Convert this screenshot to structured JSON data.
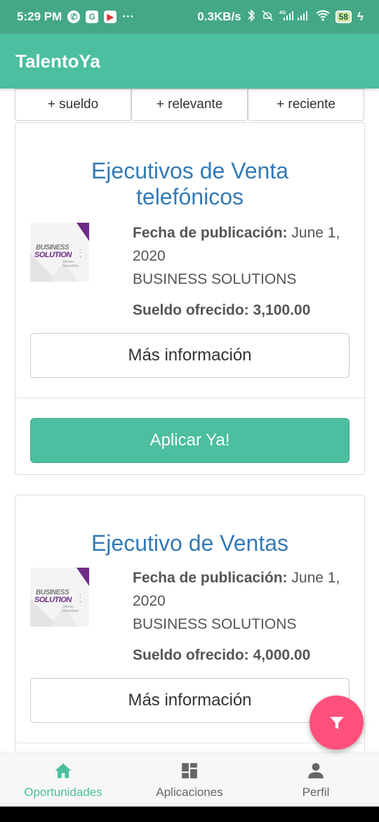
{
  "status_bar": {
    "time": "5:29 PM",
    "speed": "0.3KB/s",
    "battery": "58",
    "network_label": "4G",
    "icons": [
      "whatsapp-icon",
      "google-icon",
      "youtube-icon",
      "more-icon",
      "bluetooth-icon",
      "mute-icon",
      "signal-icon",
      "wifi-icon",
      "battery-icon",
      "charging-icon"
    ]
  },
  "app_bar": {
    "title": "TalentoYa"
  },
  "sort": {
    "salary": "+ sueldo",
    "relevant": "+ relevante",
    "recent": "+ reciente"
  },
  "jobs": [
    {
      "title": "Ejecutivos de Venta telefónicos",
      "date_label": "Fecha de publicación:",
      "date_value": "June 1, 2020",
      "company": "BUSINESS SOLUTIONS",
      "salary_label": "Sueldo ofrecido:",
      "salary_value": "3,100.00",
      "more_label": "Más información",
      "apply_label": "Aplicar Ya!",
      "logo_text": {
        "line1": "BUSINESS",
        "line2": "SOLUTION",
        "line3": "Ofimas Inmuebles"
      }
    },
    {
      "title": "Ejecutivo de Ventas",
      "date_label": "Fecha de publicación:",
      "date_value": "June 1, 2020",
      "company": "BUSINESS SOLUTIONS",
      "salary_label": "Sueldo ofrecido:",
      "salary_value": "4,000.00",
      "more_label": "Más información",
      "logo_text": {
        "line1": "BUSINESS",
        "line2": "SOLUTION",
        "line3": "Ofimas Inmuebles"
      }
    }
  ],
  "fab": {
    "icon": "filter-icon"
  },
  "bottom_nav": {
    "items": [
      {
        "label": "Oportunidades",
        "icon": "home-icon",
        "active": true
      },
      {
        "label": "Aplicaciones",
        "icon": "dashboard-icon",
        "active": false
      },
      {
        "label": "Perfil",
        "icon": "person-icon",
        "active": false
      }
    ]
  },
  "colors": {
    "primary": "#4bbf9f",
    "status_bar": "#44a887",
    "title_blue": "#337ab7",
    "fab": "#ff4f7b",
    "logo_purple": "#6d2c86"
  }
}
